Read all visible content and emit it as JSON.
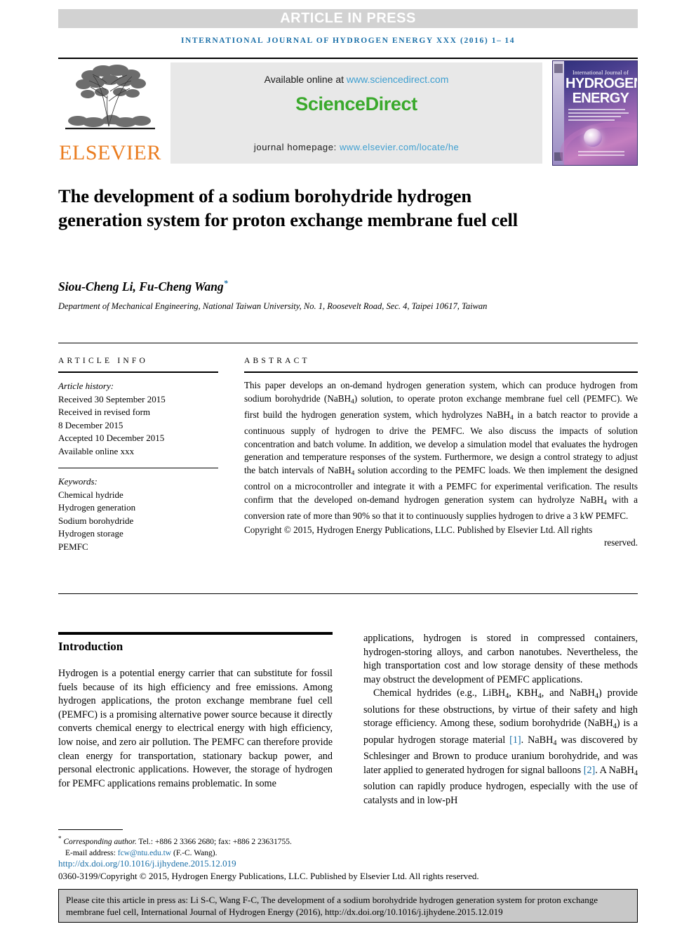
{
  "banner": {
    "article_in_press": "ARTICLE IN PRESS",
    "journal_running_head": "INTERNATIONAL JOURNAL OF HYDROGEN ENERGY XXX (2016) 1– 14"
  },
  "header": {
    "publisher_name": "ELSEVIER",
    "available_online_prefix": "Available online at ",
    "available_online_url": "www.sciencedirect.com",
    "sciencedirect_part1": "Science",
    "sciencedirect_part2": "Direct",
    "homepage_label": "journal homepage: ",
    "homepage_url": "www.elsevier.com/locate/he",
    "cover": {
      "line1": "International Journal of",
      "line2": "HYDROGEN",
      "line3": "ENERGY"
    }
  },
  "article": {
    "title": "The development of a sodium borohydride hydrogen generation system for proton exchange membrane fuel cell",
    "authors": "Siou-Cheng Li, Fu-Cheng Wang",
    "corresponding_marker": "*",
    "affiliation": "Department of Mechanical Engineering, National Taiwan University, No. 1, Roosevelt Road, Sec. 4, Taipei 10617, Taiwan"
  },
  "info": {
    "heading": "ARTICLE INFO",
    "history_label": "Article history:",
    "history": [
      "Received 30 September 2015",
      "Received in revised form",
      "8 December 2015",
      "Accepted 10 December 2015",
      "Available online xxx"
    ],
    "keywords_label": "Keywords:",
    "keywords": [
      "Chemical hydride",
      "Hydrogen generation",
      "Sodium borohydride",
      "Hydrogen storage",
      "PEMFC"
    ]
  },
  "abstract": {
    "heading": "ABSTRACT",
    "paragraph_1": "This paper develops an on-demand hydrogen generation system, which can produce hydrogen from sodium borohydride (NaBH",
    "paragraph_2": ") solution, to operate proton exchange membrane fuel cell (PEMFC). We first build the hydrogen generation system, which hydrolyzes NaBH",
    "paragraph_3": " in a batch reactor to provide a continuous supply of hydrogen to drive the PEMFC. We also discuss the impacts of solution concentration and batch volume. In addition, we develop a simulation model that evaluates the hydrogen generation and temperature responses of the system. Furthermore, we design a control strategy to adjust the batch intervals of NaBH",
    "paragraph_4": " solution according to the PEMFC loads. We then implement the designed control on a microcontroller and integrate it with a PEMFC for experimental verification. The results confirm that the developed on-demand hydrogen generation system can hydrolyze NaBH",
    "paragraph_5": " with a conversion rate of more than 90% so that it to continuously supplies hydrogen to drive a 3 kW PEMFC.",
    "copyright": "Copyright © 2015, Hydrogen Energy Publications, LLC. Published by Elsevier Ltd. All rights",
    "copyright_last": "reserved."
  },
  "introduction": {
    "section_title": "Introduction",
    "left_paragraph": "Hydrogen is a potential energy carrier that can substitute for fossil fuels because of its high efficiency and free emissions. Among hydrogen applications, the proton exchange membrane fuel cell (PEMFC) is a promising alternative power source because it directly converts chemical energy to electrical energy with high efficiency, low noise, and zero air pollution. The PEMFC can therefore provide clean energy for transportation, stationary backup power, and personal electronic applications. However, the storage of hydrogen for PEMFC applications remains problematic. In some",
    "right_paragraph_1": "applications, hydrogen is stored in compressed containers, hydrogen-storing alloys, and carbon nanotubes. Nevertheless, the high transportation cost and low storage density of these methods may obstruct the development of PEMFC applications.",
    "right_p2_a": "Chemical hydrides (e.g., LiBH",
    "right_p2_b": ", KBH",
    "right_p2_c": ", and NaBH",
    "right_p2_d": ") provide solutions for these obstructions, by virtue of their safety and high storage efficiency. Among these, sodium borohydride (NaBH",
    "right_p2_e": ") is a popular hydrogen storage material ",
    "ref_1": "[1]",
    "right_p2_f": ". NaBH",
    "right_p2_g": " was discovered by Schlesinger and Brown to produce uranium borohydride, and was later applied to generated hydrogen for signal balloons ",
    "ref_2": "[2]",
    "right_p2_h": ". A NaBH",
    "right_p2_i": " solution can rapidly produce hydrogen, especially with the use of catalysts and in low-pH"
  },
  "footer": {
    "corresponding_star": "*",
    "corresponding_label": "Corresponding author.",
    "corresponding_contact": " Tel.: +886 2 3366 2680; fax: +886 2 23631755.",
    "email_label": "E-mail address: ",
    "email": "fcw@ntu.edu.tw",
    "email_owner": " (F.-C. Wang).",
    "doi": "http://dx.doi.org/10.1016/j.ijhydene.2015.12.019",
    "issn_copyright": "0360-3199/Copyright © 2015, Hydrogen Energy Publications, LLC. Published by Elsevier Ltd. All rights reserved."
  },
  "citation_box": {
    "text": "Please cite this article in press as: Li S-C, Wang F-C, The development of a sodium borohydride hydrogen generation system for proton exchange membrane fuel cell, International Journal of Hydrogen Energy (2016), http://dx.doi.org/10.1016/j.ijhydene.2015.12.019"
  },
  "colors": {
    "banner_bg": "#d2d2d2",
    "journal_blue": "#1a6fa8",
    "elsevier_orange": "#ea7c1f",
    "sciencedirect_green": "#3aa92c",
    "link_blue": "#3f9fd0",
    "cite_box_bg": "#c8c8c8"
  }
}
